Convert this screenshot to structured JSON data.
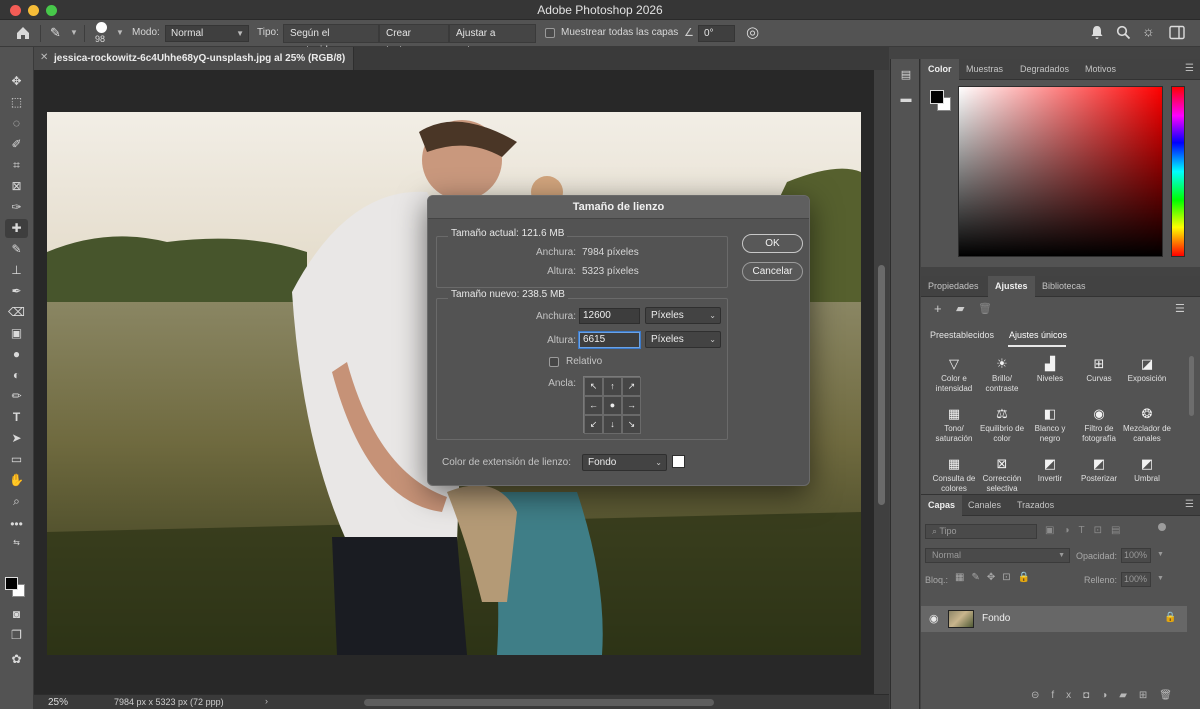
{
  "app": {
    "title": "Adobe Photoshop 2026"
  },
  "options_bar": {
    "brush_size": "98",
    "mode_label": "Modo:",
    "mode_value": "Normal",
    "type_label": "Tipo:",
    "type_buttons": [
      "Según el contenido",
      "Crear textura",
      "Ajustar a entorno"
    ],
    "sample_all_label": "Muestrear todas las capas",
    "angle_value": "0°"
  },
  "document": {
    "tab_name": "jessica-rockowitz-6c4Uhhe68yQ-unsplash.jpg al 25% (RGB/8)",
    "zoom": "25%",
    "info": "7984 px x 5323 px (72 ppp)"
  },
  "panels": {
    "color_tabs": [
      "Color",
      "Muestras",
      "Degradados",
      "Motivos"
    ],
    "color": {
      "foreground": "#000000",
      "background": "#ffffff"
    },
    "props_tabs": [
      "Propiedades",
      "Ajustes",
      "Bibliotecas"
    ],
    "adjust_subtabs": [
      "Preestablecidos",
      "Ajustes únicos"
    ],
    "adjustments": [
      {
        "label": "Color e intensidad",
        "icon": "triangle-icon"
      },
      {
        "label": "Brillo/ contraste",
        "icon": "sun-icon"
      },
      {
        "label": "Niveles",
        "icon": "levels-icon"
      },
      {
        "label": "Curvas",
        "icon": "curves-icon"
      },
      {
        "label": "Exposición",
        "icon": "exposure-icon"
      },
      {
        "label": "Tono/ saturación",
        "icon": "hue-icon"
      },
      {
        "label": "Equilibrio de color",
        "icon": "balance-icon"
      },
      {
        "label": "Blanco y negro",
        "icon": "bw-icon"
      },
      {
        "label": "Filtro de fotografía",
        "icon": "camera-icon"
      },
      {
        "label": "Mezclador de canales",
        "icon": "channel-mixer-icon"
      },
      {
        "label": "Consulta de colores",
        "icon": "grid-icon"
      },
      {
        "label": "Corrección selectiva",
        "icon": "selective-icon"
      },
      {
        "label": "Invertir",
        "icon": "invert-icon"
      },
      {
        "label": "Posterizar",
        "icon": "posterize-icon"
      },
      {
        "label": "Umbral",
        "icon": "threshold-icon"
      }
    ],
    "layers_tabs": [
      "Capas",
      "Canales",
      "Trazados"
    ],
    "layers": {
      "filter_placeholder": "Tipo",
      "blend_mode": "Normal",
      "opacity_label": "Opacidad:",
      "opacity_value": "100%",
      "lock_label": "Bloq.:",
      "fill_label": "Relleno:",
      "fill_value": "100%",
      "layer_name": "Fondo"
    }
  },
  "dialog": {
    "title": "Tamaño de lienzo",
    "current_size_label": "Tamaño actual: 121.6 MB",
    "current_width_label": "Anchura:",
    "current_width_value": "7984 píxeles",
    "current_height_label": "Altura:",
    "current_height_value": "5323 píxeles",
    "new_size_label": "Tamaño nuevo: 238.5 MB",
    "width_label": "Anchura:",
    "width_value": "12600",
    "height_label": "Altura:",
    "height_value": "6615",
    "unit": "Píxeles",
    "relative_label": "Relativo",
    "anchor_label": "Ancla:",
    "extension_label": "Color de extensión de lienzo:",
    "extension_value": "Fondo",
    "extension_color": "#ffffff",
    "ok_label": "OK",
    "cancel_label": "Cancelar"
  }
}
